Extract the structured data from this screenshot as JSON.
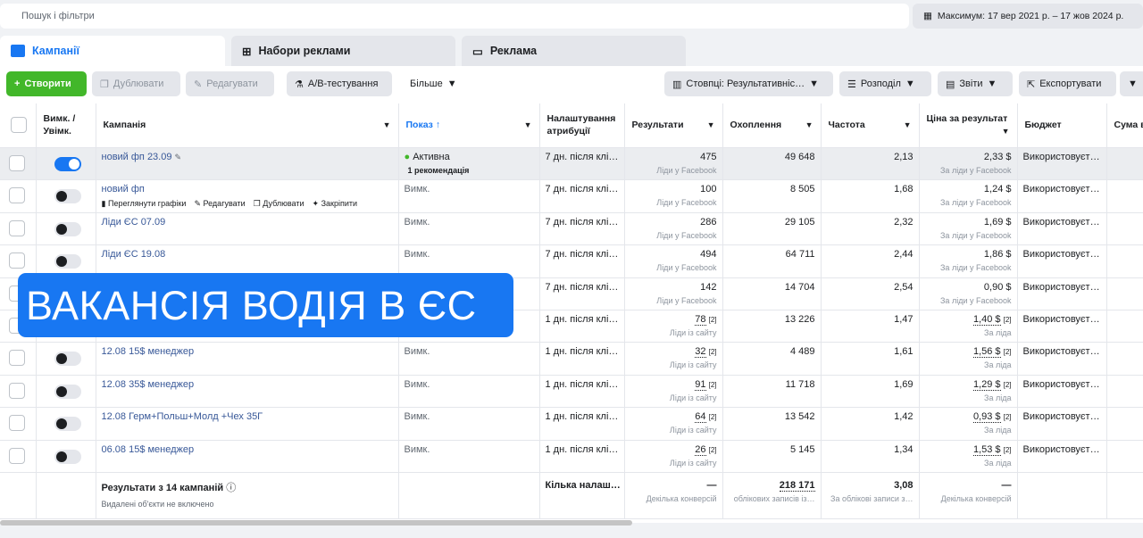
{
  "search": {
    "placeholder": "Пошук і фільтри"
  },
  "date": {
    "label": "Максимум: 17 вер 2021 р. – 17 жов 2024 р."
  },
  "tabs": [
    {
      "label": "Кампанії"
    },
    {
      "label": "Набори реклами"
    },
    {
      "label": "Реклама"
    }
  ],
  "toolbar": {
    "create": "Створити",
    "duplicate": "Дублювати",
    "edit": "Редагувати",
    "ab": "A/B-тестування",
    "more": "Більше",
    "columns": "Стовпці: Результативніс…",
    "breakdown": "Розподіл",
    "reports": "Звіти",
    "export": "Експортувати"
  },
  "headers": {
    "toggle": "Вимк. / Увімк.",
    "campaign": "Кампанія",
    "delivery": "Показ ↑",
    "attribution": "Налаштування атрибуції",
    "results": "Результати",
    "reach": "Охоплення",
    "frequency": "Частота",
    "cost": "Ціна за результат",
    "budget": "Бюджет",
    "spent": "Сума в"
  },
  "row_actions": {
    "charts": "Переглянути графіки",
    "edit": "Редагувати",
    "duplicate": "Дублювати",
    "pin": "Закріпити"
  },
  "rows": [
    {
      "name": "новий фп 23.09",
      "on": true,
      "status": "Активна",
      "rec": "1 рекомендація",
      "attr": "7 дн. після клі…",
      "res": "475",
      "res_type": "Ліди у Facebook",
      "reach": "49 648",
      "freq": "2,13",
      "cost": "2,33 $",
      "cost_type": "За ліди у Facebook",
      "budget": "Використовуєт…"
    },
    {
      "name": "новий фп",
      "on": false,
      "status": "Вимк.",
      "attr": "7 дн. після клі…",
      "res": "100",
      "res_type": "Ліди у Facebook",
      "reach": "8 505",
      "freq": "1,68",
      "cost": "1,24 $",
      "cost_type": "За ліди у Facebook",
      "budget": "Використовуєт…"
    },
    {
      "name": "Ліди ЄС 07.09",
      "on": false,
      "status": "Вимк.",
      "attr": "7 дн. після клі…",
      "res": "286",
      "res_type": "Ліди у Facebook",
      "reach": "29 105",
      "freq": "2,32",
      "cost": "1,69 $",
      "cost_type": "За ліди у Facebook",
      "budget": "Використовуєт…"
    },
    {
      "name": "Ліди ЄС 19.08",
      "on": false,
      "status": "Вимк.",
      "attr": "7 дн. після клі…",
      "res": "494",
      "res_type": "Ліди у Facebook",
      "reach": "64 711",
      "freq": "2,44",
      "cost": "1,86 $",
      "cost_type": "За ліди у Facebook",
      "budget": "Використовуєт…"
    },
    {
      "name": "",
      "on": false,
      "status": "",
      "attr": "7 дн. після клі…",
      "res": "142",
      "res_type": "Ліди у Facebook",
      "reach": "14 704",
      "freq": "2,54",
      "cost": "0,90 $",
      "cost_type": "За ліди у Facebook",
      "budget": "Використовуєт…"
    },
    {
      "name": "",
      "on": false,
      "status": "",
      "attr": "1 дн. після клі…",
      "res": "78",
      "res_type": "Ліди із сайту",
      "reach": "13 226",
      "freq": "1,47",
      "cost": "1,40 $",
      "cost_type": "За ліда",
      "budget": "Використовуєт…"
    },
    {
      "name": "12.08 15$ менеджер",
      "on": false,
      "status": "Вимк.",
      "attr": "1 дн. після клі…",
      "res": "32",
      "res_type": "Ліди із сайту",
      "reach": "4 489",
      "freq": "1,61",
      "cost": "1,56 $",
      "cost_type": "За ліда",
      "budget": "Використовуєт…"
    },
    {
      "name": "12.08 35$ менеджер",
      "on": false,
      "status": "Вимк.",
      "attr": "1 дн. після клі…",
      "res": "91",
      "res_type": "Ліди із сайту",
      "reach": "11 718",
      "freq": "1,69",
      "cost": "1,29 $",
      "cost_type": "За ліда",
      "budget": "Використовуєт…"
    },
    {
      "name": "12.08 Герм+Польш+Молд +Чех 35Г",
      "on": false,
      "status": "Вимк.",
      "attr": "1 дн. після клі…",
      "res": "64",
      "res_type": "Ліди із сайту",
      "reach": "13 542",
      "freq": "1,42",
      "cost": "0,93 $",
      "cost_type": "За ліда",
      "budget": "Використовуєт…"
    },
    {
      "name": "06.08 15$ менеджер",
      "on": false,
      "status": "Вимк.",
      "attr": "1 дн. після клі…",
      "res": "26",
      "res_type": "Ліди із сайту",
      "reach": "5 145",
      "freq": "1,34",
      "cost": "1,53 $",
      "cost_type": "За ліда",
      "budget": "Використовуєт…"
    }
  ],
  "totals": {
    "label": "Результати з 14 кампаній",
    "sub": "Видалені об'єкти не включено",
    "attr": "Кілька налаш…",
    "res": "—",
    "res_sub": "Декілька конверсій",
    "reach": "218 171",
    "reach_sub": "облікових записів із…",
    "freq": "3,08",
    "freq_sub": "За облікові записи з…",
    "cost": "—",
    "cost_sub": "Декілька конверсій"
  },
  "overlay": {
    "text": "ВАКАНСІЯ ВОДІЯ В ЄС"
  }
}
